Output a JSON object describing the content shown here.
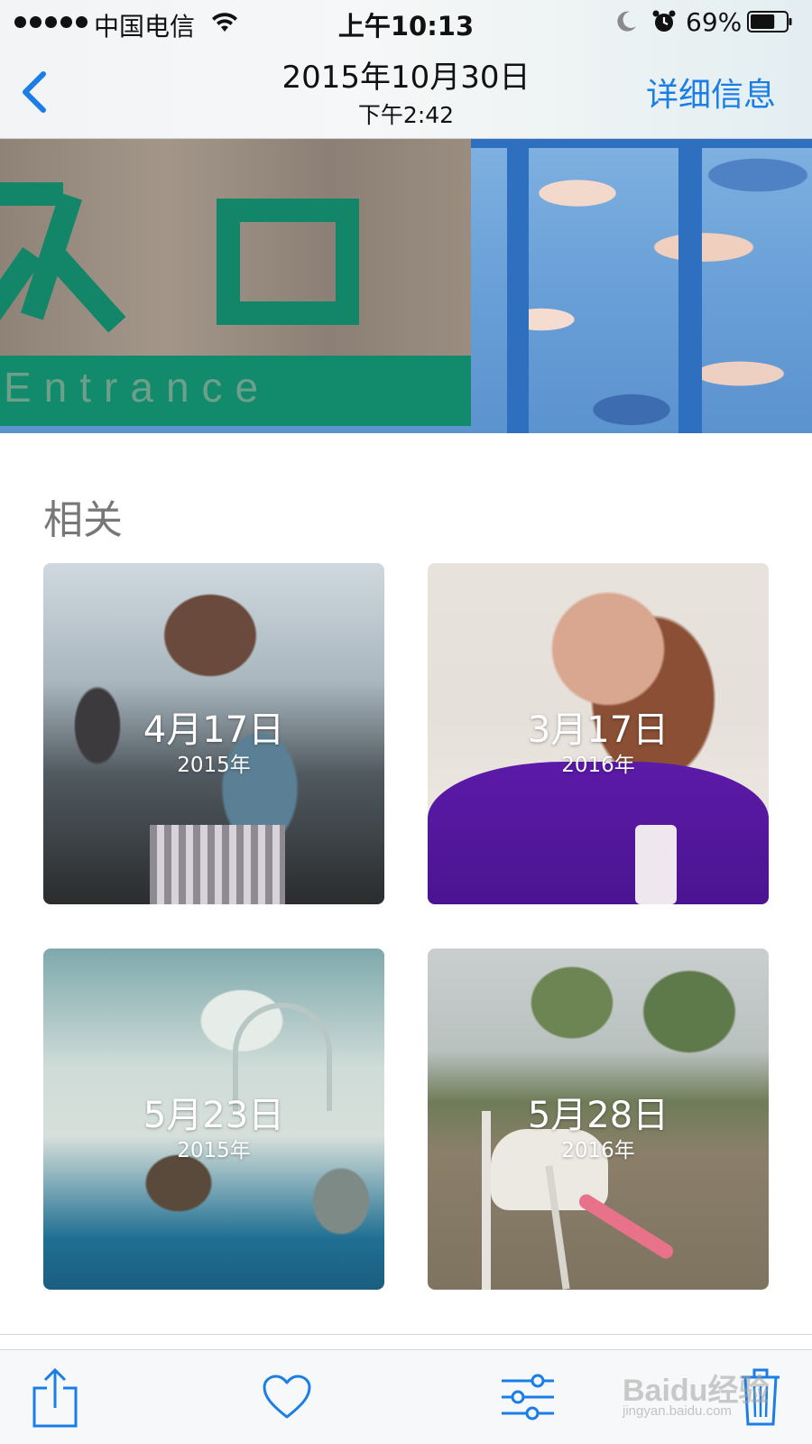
{
  "status_bar": {
    "carrier": "中国电信",
    "time": "上午10:13",
    "battery_percent": "69%",
    "battery_level": 0.69
  },
  "nav": {
    "title": "2015年10月30日",
    "subtitle": "下午2:42",
    "details_label": "详细信息"
  },
  "hero": {
    "sign_text": "Entrance"
  },
  "related": {
    "title": "相关",
    "items": [
      {
        "date": "4月17日",
        "year": "2015年"
      },
      {
        "date": "3月17日",
        "year": "2016年"
      },
      {
        "date": "5月23日",
        "year": "2015年"
      },
      {
        "date": "5月28日",
        "year": "2016年"
      }
    ]
  },
  "toolbar": {
    "icons": [
      "share-icon",
      "heart-icon",
      "edit-icon",
      "trash-icon"
    ]
  },
  "watermark": {
    "logo": "Baidu经验",
    "url": "jingyan.baidu.com"
  },
  "colors": {
    "accent": "#1a7ee6"
  }
}
